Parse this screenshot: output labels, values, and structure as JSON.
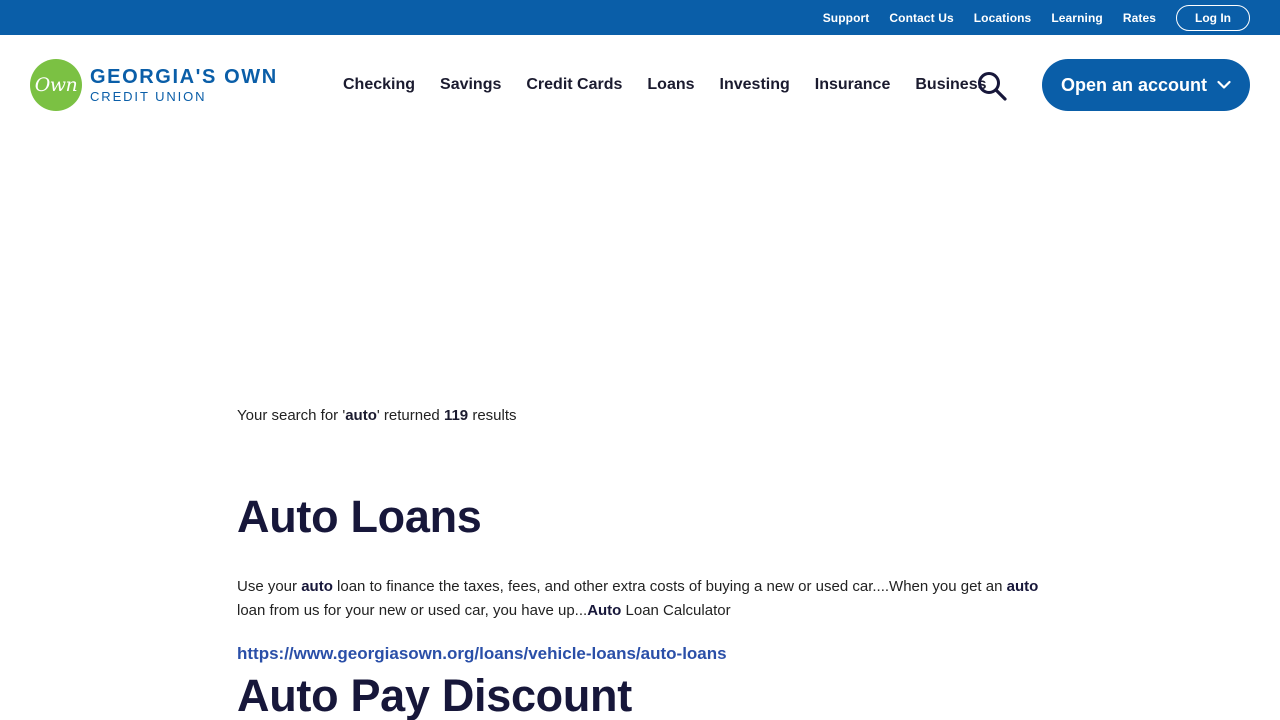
{
  "utility_nav": {
    "links": [
      "Support",
      "Contact Us",
      "Locations",
      "Learning",
      "Rates"
    ],
    "login_label": "Log In"
  },
  "logo": {
    "mark": "Own",
    "line1": "GEORGIA'S OWN",
    "line2": "CREDIT UNION"
  },
  "main_nav": {
    "items": [
      "Checking",
      "Savings",
      "Credit Cards",
      "Loans",
      "Investing",
      "Insurance",
      "Business"
    ],
    "search_icon": "search-icon",
    "open_account_label": "Open an account"
  },
  "search": {
    "prefix": "Your search for '",
    "term": "auto",
    "middle": "' returned ",
    "count": "119",
    "suffix": " results"
  },
  "results": [
    {
      "title": "Auto Loans",
      "snippet": [
        {
          "text": "Use your ",
          "bold": false
        },
        {
          "text": "auto",
          "bold": true
        },
        {
          "text": " loan to finance the taxes, fees, and other extra costs of buying a new or used car....When you get an ",
          "bold": false
        },
        {
          "text": "auto",
          "bold": true
        },
        {
          "text": " loan from us for your new or used car, you have up...",
          "bold": false
        },
        {
          "text": "Auto",
          "bold": true
        },
        {
          "text": " Loan Calculator",
          "bold": false
        }
      ],
      "url": "https://www.georgiasown.org/loans/vehicle-loans/auto-loans"
    },
    {
      "title": "Auto Pay Discount"
    }
  ],
  "colors": {
    "brand_blue": "#0a5ea8",
    "brand_green": "#7bc143",
    "link_blue": "#2a4fa8",
    "heading": "#17173a"
  }
}
